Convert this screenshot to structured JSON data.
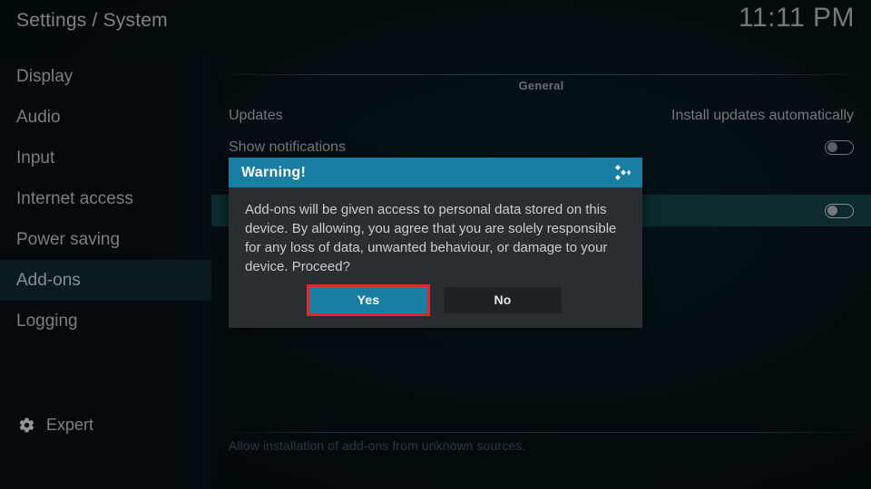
{
  "header": {
    "breadcrumb": "Settings / System",
    "clock": "11:11 PM"
  },
  "sidebar": {
    "items": [
      {
        "label": "Display",
        "selected": false
      },
      {
        "label": "Audio",
        "selected": false
      },
      {
        "label": "Input",
        "selected": false
      },
      {
        "label": "Internet access",
        "selected": false
      },
      {
        "label": "Power saving",
        "selected": false
      },
      {
        "label": "Add-ons",
        "selected": true
      },
      {
        "label": "Logging",
        "selected": false
      }
    ],
    "level": {
      "label": "Expert",
      "icon": "gear-icon"
    }
  },
  "main": {
    "group_title": "General",
    "rows": [
      {
        "label": "Updates",
        "value": "Install updates automatically",
        "control": "text",
        "focused": false
      },
      {
        "label": "Show notifications",
        "value": "",
        "control": "toggle",
        "toggle_on": false,
        "focused": false
      },
      {
        "label": "",
        "value": "",
        "control": "none",
        "focused": false
      },
      {
        "label": "",
        "value": "",
        "control": "toggle",
        "toggle_on": false,
        "focused": true
      }
    ],
    "description": "Allow installation of add-ons from unknown sources."
  },
  "dialog": {
    "title": "Warning!",
    "logo_icon": "kodi-logo-icon",
    "message": "Add-ons will be given access to personal data stored on this device. By allowing, you agree that you are solely responsible for any loss of data, unwanted behaviour, or damage to your device. Proceed?",
    "buttons": {
      "yes": "Yes",
      "no": "No"
    }
  },
  "colors": {
    "accent": "#1a7ea3",
    "focus_outline": "#e8262a",
    "row_focus_bg": "#11343a",
    "dialog_bg": "#2a2e31"
  }
}
